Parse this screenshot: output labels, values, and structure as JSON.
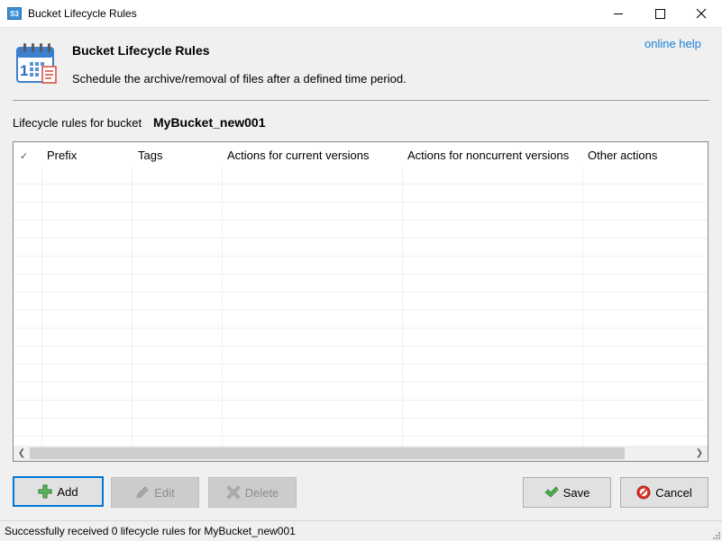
{
  "window": {
    "title": "Bucket Lifecycle Rules",
    "app_icon_text": "S3"
  },
  "header": {
    "title": "Bucket Lifecycle Rules",
    "subtitle": "Schedule the archive/removal of files after a defined time period.",
    "help_link": "online help"
  },
  "bucket": {
    "label": "Lifecycle rules for bucket",
    "name": "MyBucket_new001"
  },
  "grid": {
    "columns": [
      "✓",
      "Prefix",
      "Tags",
      "Actions for current versions",
      "Actions for noncurrent versions",
      "Other actions"
    ],
    "rows": []
  },
  "buttons": {
    "add": "Add",
    "edit": "Edit",
    "delete": "Delete",
    "save": "Save",
    "cancel": "Cancel"
  },
  "status": {
    "text": "Successfully received 0 lifecycle rules for MyBucket_new001"
  },
  "colors": {
    "accent": "#0078d7",
    "link": "#1a7fd6",
    "add_icon": "#3aa03a",
    "cancel_icon": "#d42020"
  }
}
